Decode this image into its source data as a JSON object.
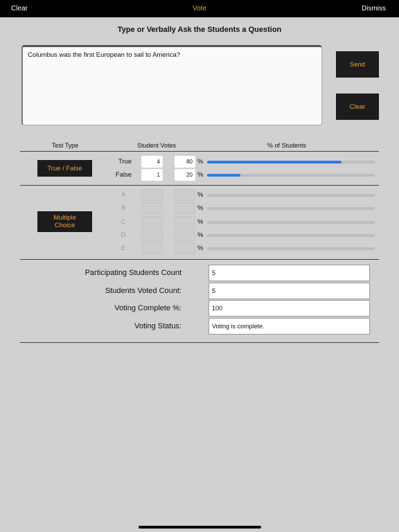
{
  "nav": {
    "left": "Clear",
    "title": "Vote",
    "right": "Dismiss"
  },
  "prompt": "Type or Verbally Ask the Students a Question",
  "question": "Columbus was the first European to sail to America?",
  "buttons": {
    "send": "Send",
    "clear": "Clear"
  },
  "headers": {
    "test_type": "Test Type",
    "student_votes": "Student Votes",
    "pct_students": "% of Students"
  },
  "true_false": {
    "label": "True / False",
    "options": [
      {
        "label": "True",
        "votes": "4",
        "percent": "80",
        "fraction": 0.8
      },
      {
        "label": "False",
        "votes": "1",
        "percent": "20",
        "fraction": 0.2
      }
    ]
  },
  "multiple_choice": {
    "label_line1": "Multiple",
    "label_line2": "Choice",
    "options": [
      {
        "label": "A"
      },
      {
        "label": "B"
      },
      {
        "label": "C"
      },
      {
        "label": "D"
      },
      {
        "label": "E"
      }
    ]
  },
  "pct_symbol": "%",
  "stats": {
    "participating": {
      "label": "Participating Students Count",
      "value": "5"
    },
    "voted": {
      "label": "Students Voted Count:",
      "value": "5"
    },
    "complete": {
      "label": "Voting Complete %:",
      "value": "100"
    },
    "status": {
      "label": "Voting Status:",
      "value": "Voting is complete."
    }
  },
  "colors": {
    "accent": "#e8a23a",
    "bar": "#2f7ae5"
  }
}
